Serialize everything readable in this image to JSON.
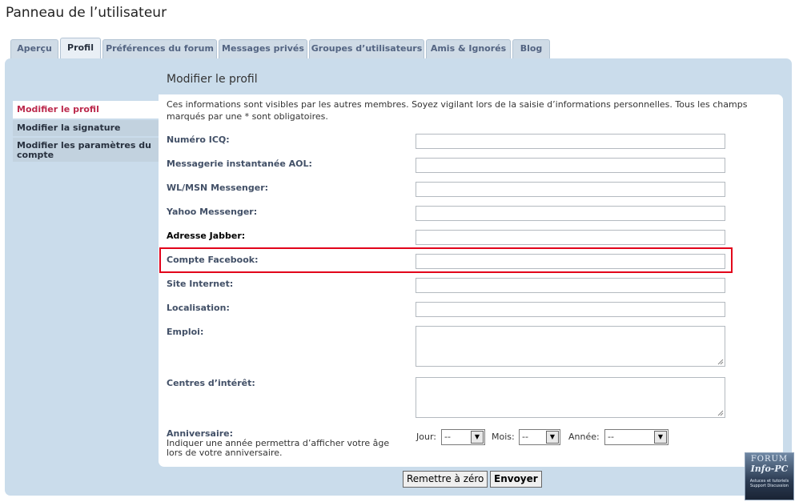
{
  "page_title": "Panneau de l’utilisateur",
  "tabs": [
    {
      "label": "Aperçu"
    },
    {
      "label": "Profil"
    },
    {
      "label": "Préférences du forum"
    },
    {
      "label": "Messages privés"
    },
    {
      "label": "Groupes d’utilisateurs"
    },
    {
      "label": "Amis & Ignorés"
    },
    {
      "label": "Blog"
    }
  ],
  "sidebar": {
    "items": [
      {
        "label": "Modifier le profil"
      },
      {
        "label": "Modifier la signature"
      },
      {
        "label": "Modifier les paramètres du compte"
      }
    ]
  },
  "section_title": "Modifier le profil",
  "intro": "Ces informations sont visibles par les autres membres. Soyez vigilant lors de la saisie d’informations personnelles. Tous les champs marqués par une * sont obligatoires.",
  "fields": {
    "icq": {
      "label": "Numéro ICQ:",
      "value": ""
    },
    "aol": {
      "label": "Messagerie instantanée AOL:",
      "value": ""
    },
    "msn": {
      "label": "WL/MSN Messenger:",
      "value": ""
    },
    "yahoo": {
      "label": "Yahoo Messenger:",
      "value": ""
    },
    "jabber": {
      "label": "Adresse Jabber:",
      "value": ""
    },
    "facebook": {
      "label": "Compte Facebook:",
      "value": ""
    },
    "website": {
      "label": "Site Internet:",
      "value": ""
    },
    "location": {
      "label": "Localisation:",
      "value": ""
    },
    "occupation": {
      "label": "Emploi:",
      "value": ""
    },
    "interests": {
      "label": "Centres d’intérêt:",
      "value": ""
    }
  },
  "birthday": {
    "label": "Anniversaire:",
    "hint": "Indiquer une année permettra d’afficher votre âge lors de votre anniversaire.",
    "day_label": "Jour:",
    "day_value": "--",
    "month_label": "Mois:",
    "month_value": "--",
    "year_label": "Année:",
    "year_value": "--"
  },
  "buttons": {
    "reset": "Remettre à zéro",
    "submit": "Envoyer"
  },
  "logo": {
    "line1": "FORUM",
    "line2": "Info-PC",
    "line3": "Astuces et tutoriels Support Discussion"
  },
  "colors": {
    "panel_bg": "#cadceb",
    "tab_bg": "#cfdbe6",
    "active_nav_text": "#bc2a4d",
    "highlight_border": "#e2001a",
    "label_text": "#425067"
  }
}
